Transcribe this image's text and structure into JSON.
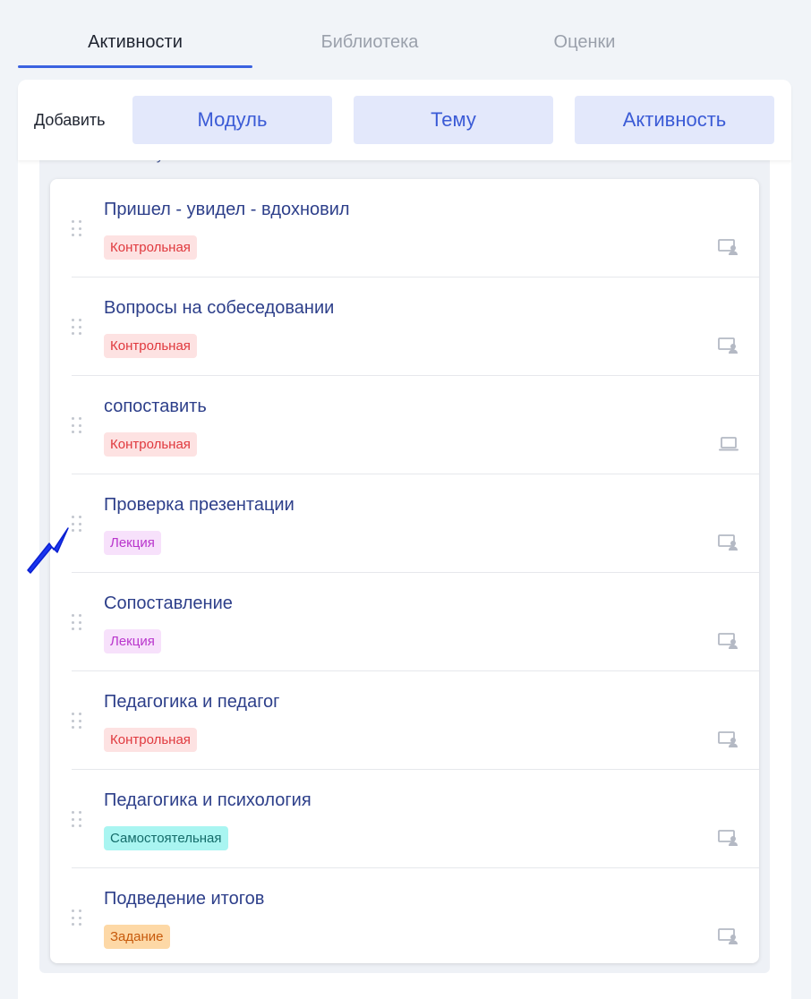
{
  "tabs": [
    {
      "label": "Активности",
      "active": true
    },
    {
      "label": "Библиотека",
      "active": false
    },
    {
      "label": "Оценки",
      "active": false
    }
  ],
  "toolbar": {
    "add_label": "Добавить",
    "module_btn": "Модуль",
    "topic_btn": "Тему",
    "activity_btn": "Активность"
  },
  "activities": [
    {
      "title": "Пришел - увидел - вдохновил",
      "badge": "Контрольная",
      "badge_color": "red",
      "icon": "classroom-icon"
    },
    {
      "title": "Вопросы на собеседовании",
      "badge": "Контрольная",
      "badge_color": "red",
      "icon": "classroom-icon"
    },
    {
      "title": "сопоставить",
      "badge": "Контрольная",
      "badge_color": "red",
      "icon": "laptop-icon"
    },
    {
      "title": "Проверка презентации",
      "badge": "Лекция",
      "badge_color": "purple",
      "icon": "classroom-icon"
    },
    {
      "title": "Сопоставление",
      "badge": "Лекция",
      "badge_color": "purple",
      "icon": "classroom-icon"
    },
    {
      "title": "Педагогика и педагог",
      "badge": "Контрольная",
      "badge_color": "red",
      "icon": "classroom-icon"
    },
    {
      "title": "Педагогика и психология",
      "badge": "Самостоятельная",
      "badge_color": "cyan",
      "icon": "classroom-icon"
    },
    {
      "title": "Подведение итогов",
      "badge": "Задание",
      "badge_color": "orange",
      "icon": "classroom-icon"
    }
  ],
  "colors": {
    "accent": "#3b62e0",
    "button_bg": "#e3e8fb",
    "title_text": "#2d3f8a",
    "annotation_arrow": "#1a35f0"
  }
}
